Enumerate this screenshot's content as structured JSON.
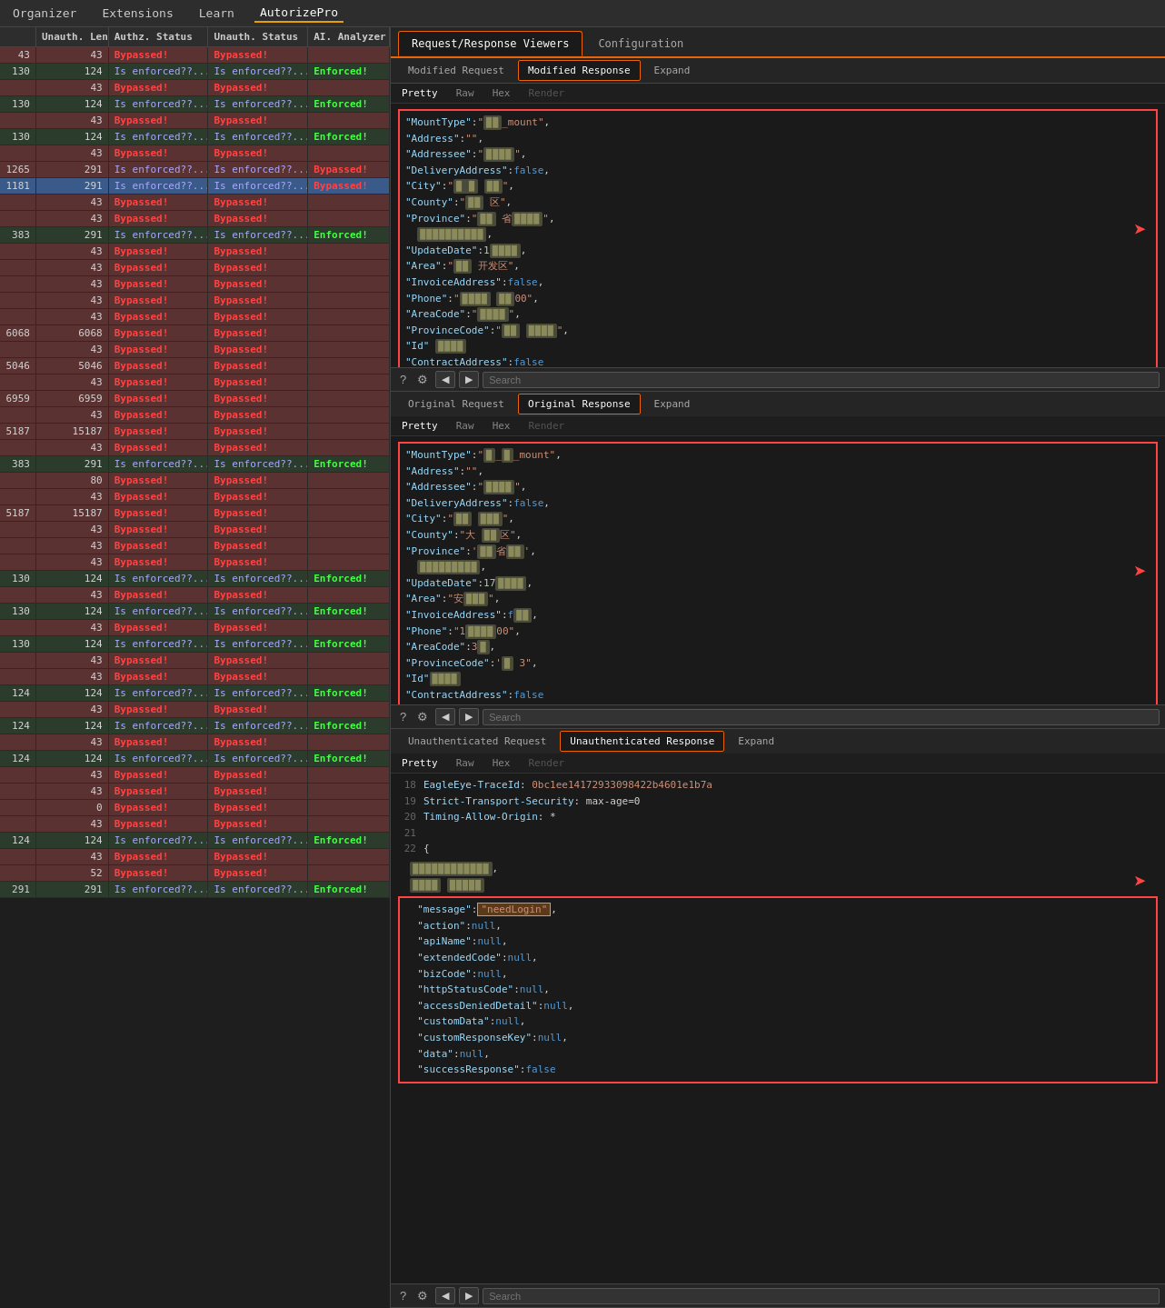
{
  "topnav": {
    "items": [
      "Organizer",
      "Extensions",
      "Learn",
      "AutorizePro"
    ],
    "active": "AutorizePro"
  },
  "table": {
    "headers": {
      "unauth_len": "Unauth. Len",
      "authz_status": "Authz. Status",
      "unauth_status": "Unauth. Status",
      "ai_analyzer": "AI. Analyzer"
    },
    "rows": [
      {
        "id": "43",
        "ulen": "43",
        "authz": "Bypassed!",
        "unauthz": "Bypassed!",
        "ai": "",
        "style": "bypassed"
      },
      {
        "id": "130",
        "ulen": "124",
        "authz": "Is enforced??...",
        "unauthz": "Is enforced??...",
        "ai": "Enforced!",
        "style": "enforced"
      },
      {
        "id": "",
        "ulen": "43",
        "authz": "Bypassed!",
        "unauthz": "Bypassed!",
        "ai": "",
        "style": "bypassed"
      },
      {
        "id": "130",
        "ulen": "124",
        "authz": "Is enforced??...",
        "unauthz": "Is enforced??...",
        "ai": "Enforced!",
        "style": "enforced"
      },
      {
        "id": "",
        "ulen": "43",
        "authz": "Bypassed!",
        "unauthz": "Bypassed!",
        "ai": "",
        "style": "bypassed"
      },
      {
        "id": "130",
        "ulen": "124",
        "authz": "Is enforced??...",
        "unauthz": "Is enforced??...",
        "ai": "Enforced!",
        "style": "enforced"
      },
      {
        "id": "",
        "ulen": "43",
        "authz": "Bypassed!",
        "unauthz": "Bypassed!",
        "ai": "",
        "style": "bypassed"
      },
      {
        "id": "1265",
        "ulen": "291",
        "authz": "Is enforced??...",
        "unauthz": "Is enforced??...",
        "ai": "Bypassed!",
        "style": "bypassed"
      },
      {
        "id": "1181",
        "ulen": "291",
        "authz": "Is enforced??...",
        "unauthz": "Is enforced??...",
        "ai": "Bypassed!",
        "style": "selected"
      },
      {
        "id": "",
        "ulen": "43",
        "authz": "Bypassed!",
        "unauthz": "Bypassed!",
        "ai": "",
        "style": "bypassed"
      },
      {
        "id": "",
        "ulen": "43",
        "authz": "Bypassed!",
        "unauthz": "Bypassed!",
        "ai": "",
        "style": "bypassed"
      },
      {
        "id": "383",
        "ulen": "291",
        "authz": "Is enforced??...",
        "unauthz": "Is enforced??...",
        "ai": "Enforced!",
        "style": "enforced"
      },
      {
        "id": "",
        "ulen": "43",
        "authz": "Bypassed!",
        "unauthz": "Bypassed!",
        "ai": "",
        "style": "bypassed"
      },
      {
        "id": "",
        "ulen": "43",
        "authz": "Bypassed!",
        "unauthz": "Bypassed!",
        "ai": "",
        "style": "bypassed"
      },
      {
        "id": "",
        "ulen": "43",
        "authz": "Bypassed!",
        "unauthz": "Bypassed!",
        "ai": "",
        "style": "bypassed"
      },
      {
        "id": "",
        "ulen": "43",
        "authz": "Bypassed!",
        "unauthz": "Bypassed!",
        "ai": "",
        "style": "bypassed"
      },
      {
        "id": "",
        "ulen": "43",
        "authz": "Bypassed!",
        "unauthz": "Bypassed!",
        "ai": "",
        "style": "bypassed"
      },
      {
        "id": "6068",
        "ulen": "6068",
        "authz": "Bypassed!",
        "unauthz": "Bypassed!",
        "ai": "",
        "style": "bypassed"
      },
      {
        "id": "",
        "ulen": "43",
        "authz": "Bypassed!",
        "unauthz": "Bypassed!",
        "ai": "",
        "style": "bypassed"
      },
      {
        "id": "5046",
        "ulen": "5046",
        "authz": "Bypassed!",
        "unauthz": "Bypassed!",
        "ai": "",
        "style": "bypassed"
      },
      {
        "id": "",
        "ulen": "43",
        "authz": "Bypassed!",
        "unauthz": "Bypassed!",
        "ai": "",
        "style": "bypassed"
      },
      {
        "id": "6959",
        "ulen": "6959",
        "authz": "Bypassed!",
        "unauthz": "Bypassed!",
        "ai": "",
        "style": "bypassed"
      },
      {
        "id": "",
        "ulen": "43",
        "authz": "Bypassed!",
        "unauthz": "Bypassed!",
        "ai": "",
        "style": "bypassed"
      },
      {
        "id": "5187",
        "ulen": "15187",
        "authz": "Bypassed!",
        "unauthz": "Bypassed!",
        "ai": "",
        "style": "bypassed"
      },
      {
        "id": "",
        "ulen": "43",
        "authz": "Bypassed!",
        "unauthz": "Bypassed!",
        "ai": "",
        "style": "bypassed"
      },
      {
        "id": "383",
        "ulen": "291",
        "authz": "Is enforced??...",
        "unauthz": "Is enforced??...",
        "ai": "Enforced!",
        "style": "enforced"
      },
      {
        "id": "",
        "ulen": "80",
        "authz": "Bypassed!",
        "unauthz": "Bypassed!",
        "ai": "",
        "style": "bypassed"
      },
      {
        "id": "",
        "ulen": "43",
        "authz": "Bypassed!",
        "unauthz": "Bypassed!",
        "ai": "",
        "style": "bypassed"
      },
      {
        "id": "5187",
        "ulen": "15187",
        "authz": "Bypassed!",
        "unauthz": "Bypassed!",
        "ai": "",
        "style": "bypassed"
      },
      {
        "id": "",
        "ulen": "43",
        "authz": "Bypassed!",
        "unauthz": "Bypassed!",
        "ai": "",
        "style": "bypassed"
      },
      {
        "id": "",
        "ulen": "43",
        "authz": "Bypassed!",
        "unauthz": "Bypassed!",
        "ai": "",
        "style": "bypassed"
      },
      {
        "id": "",
        "ulen": "43",
        "authz": "Bypassed!",
        "unauthz": "Bypassed!",
        "ai": "",
        "style": "bypassed"
      },
      {
        "id": "130",
        "ulen": "124",
        "authz": "Is enforced??...",
        "unauthz": "Is enforced??...",
        "ai": "Enforced!",
        "style": "enforced"
      },
      {
        "id": "",
        "ulen": "43",
        "authz": "Bypassed!",
        "unauthz": "Bypassed!",
        "ai": "",
        "style": "bypassed"
      },
      {
        "id": "130",
        "ulen": "124",
        "authz": "Is enforced??...",
        "unauthz": "Is enforced??...",
        "ai": "Enforced!",
        "style": "enforced"
      },
      {
        "id": "",
        "ulen": "43",
        "authz": "Bypassed!",
        "unauthz": "Bypassed!",
        "ai": "",
        "style": "bypassed"
      },
      {
        "id": "130",
        "ulen": "124",
        "authz": "Is enforced??...",
        "unauthz": "Is enforced??...",
        "ai": "Enforced!",
        "style": "enforced"
      },
      {
        "id": "",
        "ulen": "43",
        "authz": "Bypassed!",
        "unauthz": "Bypassed!",
        "ai": "",
        "style": "bypassed"
      },
      {
        "id": "",
        "ulen": "43",
        "authz": "Bypassed!",
        "unauthz": "Bypassed!",
        "ai": "",
        "style": "bypassed"
      },
      {
        "id": "124",
        "ulen": "124",
        "authz": "Is enforced??...",
        "unauthz": "Is enforced??...",
        "ai": "Enforced!",
        "style": "enforced"
      },
      {
        "id": "",
        "ulen": "43",
        "authz": "Bypassed!",
        "unauthz": "Bypassed!",
        "ai": "",
        "style": "bypassed"
      },
      {
        "id": "124",
        "ulen": "124",
        "authz": "Is enforced??...",
        "unauthz": "Is enforced??...",
        "ai": "Enforced!",
        "style": "enforced"
      },
      {
        "id": "",
        "ulen": "43",
        "authz": "Bypassed!",
        "unauthz": "Bypassed!",
        "ai": "",
        "style": "bypassed"
      },
      {
        "id": "124",
        "ulen": "124",
        "authz": "Is enforced??...",
        "unauthz": "Is enforced??...",
        "ai": "Enforced!",
        "style": "enforced"
      },
      {
        "id": "",
        "ulen": "43",
        "authz": "Bypassed!",
        "unauthz": "Bypassed!",
        "ai": "",
        "style": "bypassed"
      },
      {
        "id": "",
        "ulen": "43",
        "authz": "Bypassed!",
        "unauthz": "Bypassed!",
        "ai": "",
        "style": "bypassed"
      },
      {
        "id": "",
        "ulen": "0",
        "authz": "Bypassed!",
        "unauthz": "Bypassed!",
        "ai": "",
        "style": "bypassed"
      },
      {
        "id": "",
        "ulen": "43",
        "authz": "Bypassed!",
        "unauthz": "Bypassed!",
        "ai": "",
        "style": "bypassed"
      },
      {
        "id": "124",
        "ulen": "124",
        "authz": "Is enforced??...",
        "unauthz": "Is enforced??...",
        "ai": "Enforced!",
        "style": "enforced"
      },
      {
        "id": "",
        "ulen": "43",
        "authz": "Bypassed!",
        "unauthz": "Bypassed!",
        "ai": "",
        "style": "bypassed"
      },
      {
        "id": "",
        "ulen": "52",
        "authz": "Bypassed!",
        "unauthz": "Bypassed!",
        "ai": "",
        "style": "bypassed"
      },
      {
        "id": "291",
        "ulen": "291",
        "authz": "Is enforced??...",
        "unauthz": "Is enforced??...",
        "ai": "Enforced!",
        "style": "enforced"
      }
    ]
  },
  "viewer": {
    "tabs": [
      "Request/Response Viewers",
      "Configuration"
    ],
    "active_tab": "Request/Response Viewers",
    "sub_tabs": [
      "Modified Request",
      "Modified Response",
      "Expand"
    ],
    "active_sub_tab": "Modified Response"
  },
  "modified_response": {
    "section_tabs": [
      "Modified Request",
      "Modified Response",
      "Expand"
    ],
    "active_section_tab": "Modified Response",
    "format_tabs": [
      "Pretty",
      "Raw",
      "Hex",
      "Render"
    ],
    "active_format": "Pretty",
    "content": {
      "mount_type": "\"__mount\"",
      "address": "\"\"",
      "addressee": "",
      "delivery_address": "false",
      "city": "",
      "county": "\"区\"",
      "province": "",
      "update_date": "1",
      "area": "\"开发区\"",
      "invoice_address": "false",
      "phone": "",
      "area_code": "",
      "province_code": "",
      "id": "",
      "contract_address": "false"
    }
  },
  "original_response": {
    "section_tabs": [
      "Original Request",
      "Original Response",
      "Expand"
    ],
    "active_section_tab": "Original Response",
    "format_tabs": [
      "Pretty",
      "Raw",
      "Hex",
      "Render"
    ],
    "active_format": "Pretty",
    "content": {
      "mount_type": "\"__mount\"",
      "address": "\"\"",
      "addressee": "",
      "delivery_address": "false",
      "city": "",
      "county": "\"大 区\"",
      "province": "",
      "update_date": "17",
      "area": "\"安 \"",
      "invoice_address": "f",
      "phone": "\"1",
      "area_code": "3",
      "province_code": "3\"",
      "id": "",
      "contract_address": "false"
    }
  },
  "unauthenticated_response": {
    "section_tabs": [
      "Unauthenticated Request",
      "Unauthenticated Response",
      "Expand"
    ],
    "active_section_tab": "Unauthenticated Response",
    "format_tabs": [
      "Pretty",
      "Raw",
      "Hex",
      "Render"
    ],
    "active_format": "Pretty",
    "header_lines": [
      {
        "num": "18",
        "text": "EagleEye-TraceId: 0bc1ee14172933098422b4601e1b7a"
      },
      {
        "num": "19",
        "text": "Strict-Transport-Security: max-age=0"
      },
      {
        "num": "20",
        "text": "Timing-Allow-Origin: *"
      },
      {
        "num": "21",
        "text": ""
      },
      {
        "num": "22",
        "text": "{"
      }
    ],
    "json_content": {
      "code": "\"10\"",
      "message": "\"needLogin\"",
      "action": "null",
      "apiName": "null",
      "extendedCode": "null",
      "bizCode": "null",
      "httpStatusCode": "null",
      "accessDeniedDetail": "null",
      "customData": "null",
      "customResponseKey": "null",
      "data": "null",
      "successResponse": "false"
    }
  },
  "search": {
    "placeholder": "Search",
    "placeholder2": "Search",
    "placeholder3": "Search"
  }
}
